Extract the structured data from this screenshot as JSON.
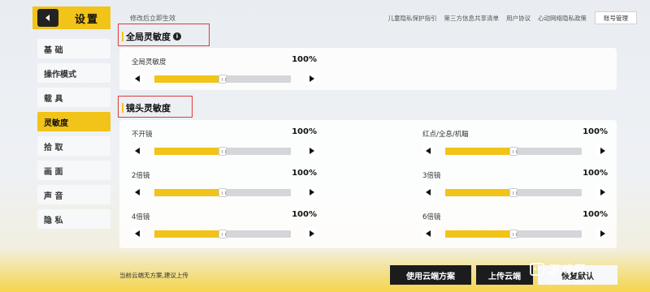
{
  "header": {
    "title": "设置",
    "hint": "修改后立即生效",
    "links": [
      "儿童隐私保护指引",
      "第三方信息共享清单",
      "用户协议",
      "心动网络隐私政策"
    ],
    "account_button": "账号管理"
  },
  "sidebar": {
    "items": [
      {
        "label": "基 础",
        "active": false
      },
      {
        "label": "操作模式",
        "active": false
      },
      {
        "label": "载 具",
        "active": false
      },
      {
        "label": "灵敏度",
        "active": true
      },
      {
        "label": "拾 取",
        "active": false
      },
      {
        "label": "画 面",
        "active": false
      },
      {
        "label": "声 音",
        "active": false
      },
      {
        "label": "隐 私",
        "active": false
      }
    ]
  },
  "global_section": {
    "title": "全局灵敏度",
    "sliders": [
      {
        "label": "全局灵敏度",
        "value": "100%",
        "fill_percent": 50
      }
    ]
  },
  "camera_section": {
    "title": "镜头灵敏度",
    "sliders": [
      {
        "label": "不开镜",
        "value": "100%",
        "fill_percent": 50
      },
      {
        "label": "红点/全息/机瞄",
        "value": "100%",
        "fill_percent": 50
      },
      {
        "label": "2倍镜",
        "value": "100%",
        "fill_percent": 50
      },
      {
        "label": "3倍镜",
        "value": "100%",
        "fill_percent": 50
      },
      {
        "label": "4倍镜",
        "value": "100%",
        "fill_percent": 50
      },
      {
        "label": "6倍镜",
        "value": "100%",
        "fill_percent": 50
      }
    ]
  },
  "footer": {
    "hint": "当前云端无方案,建议上传",
    "use_cloud": "使用云端方案",
    "upload": "上传云端",
    "reset": "恢复默认"
  },
  "watermark": {
    "text": "游戏网",
    "sub": "www.k1..com"
  },
  "colors": {
    "accent": "#f2c318",
    "highlight_box": "#e0393a",
    "dark_button": "#1c1c1c"
  }
}
